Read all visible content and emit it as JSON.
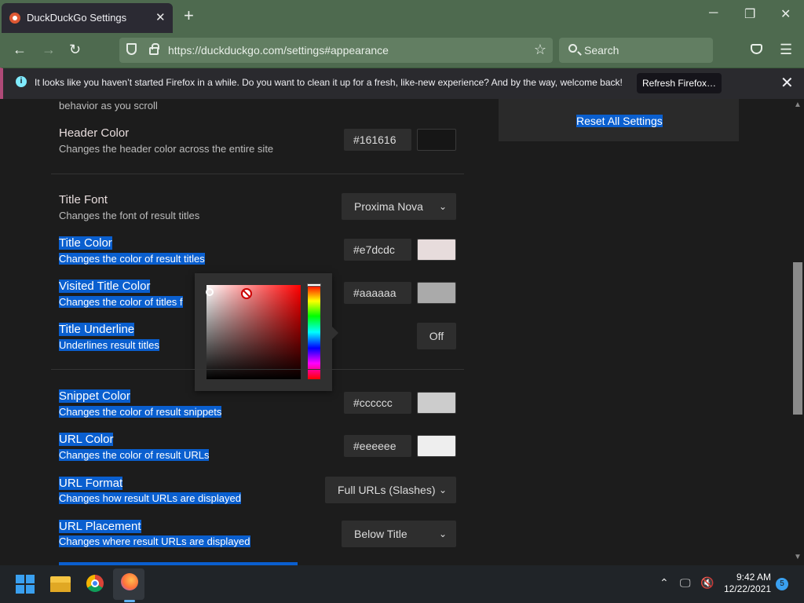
{
  "browser": {
    "tab_title": "DuckDuckGo Settings",
    "url": "https://duckduckgo.com/settings#appearance",
    "search_placeholder": "Search",
    "notification_message": "It looks like you haven’t started Firefox in a while. Do you want to clean it up for a fresh, like-new experience? And by the way, welcome back!",
    "refresh_button": "Refresh Firefox…"
  },
  "settings": {
    "partial_desc": "behavior as you scroll",
    "header_color": {
      "label": "Header Color",
      "desc": "Changes the header color across the entire site",
      "value": "#161616",
      "swatch": "#161616"
    },
    "title_font": {
      "label": "Title Font",
      "desc": "Changes the font of result titles",
      "value": "Proxima Nova"
    },
    "title_color": {
      "label": "Title Color",
      "desc": "Changes the color of result titles",
      "value": "#e7dcdc",
      "swatch": "#e7dcdc"
    },
    "visited_title_color": {
      "label": "Visited Title Color",
      "desc": "Changes the color of titles f",
      "value": "#aaaaaa",
      "swatch": "#aaaaaa"
    },
    "title_underline": {
      "label": "Title Underline",
      "desc": "Underlines result titles",
      "value": "Off"
    },
    "snippet_color": {
      "label": "Snippet Color",
      "desc": "Changes the color of result snippets",
      "value": "#cccccc",
      "swatch": "#cccccc"
    },
    "url_color": {
      "label": "URL Color",
      "desc": "Changes the color of result URLs",
      "value": "#eeeeee",
      "swatch": "#eeeeee"
    },
    "url_format": {
      "label": "URL Format",
      "desc": "Changes how result URLs are displayed",
      "value": "Full URLs (Slashes)"
    },
    "url_placement": {
      "label": "URL Placement",
      "desc": "Changes where result URLs are displayed",
      "value": "Below Title"
    },
    "reset_all": "Reset All Settings"
  },
  "taskbar": {
    "time": "9:42 AM",
    "date": "12/22/2021",
    "notification_count": "5"
  },
  "colors": {
    "highlight": "#0a5fcf",
    "chrome_green": "#4e6a4f",
    "page_bg": "#1c1c1c"
  }
}
